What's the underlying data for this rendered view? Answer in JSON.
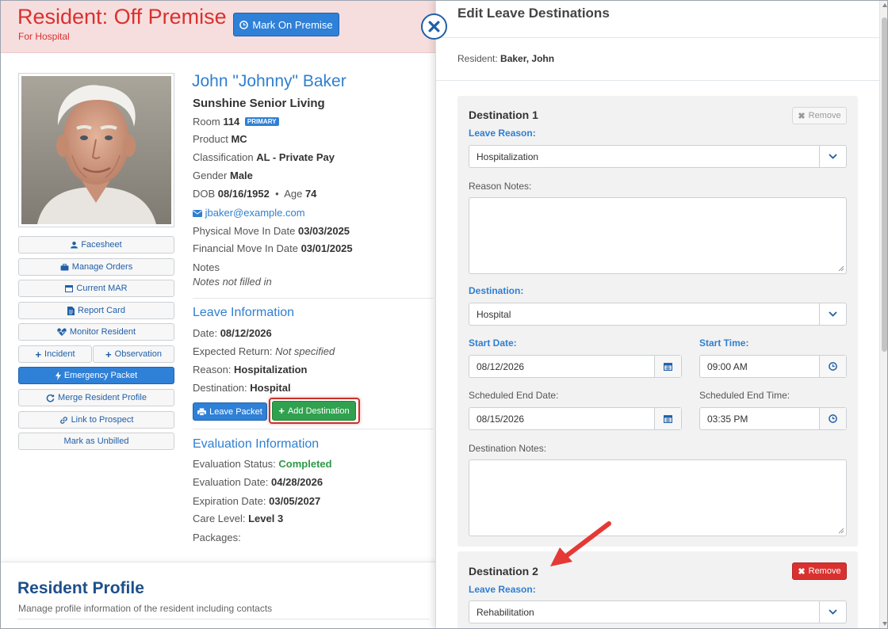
{
  "banner": {
    "title": "Resident: Off Premise",
    "subtitle": "For Hospital",
    "mark_on_premise": "Mark On Premise"
  },
  "side_buttons": {
    "facesheet": "Facesheet",
    "manage_orders": "Manage Orders",
    "current_mar": "Current MAR",
    "report_card": "Report Card",
    "monitor_resident": "Monitor Resident",
    "incident": "Incident",
    "observation": "Observation",
    "emergency_packet": "Emergency Packet",
    "merge_profile": "Merge Resident Profile",
    "link_prospect": "Link to Prospect",
    "mark_unbilled": "Mark as Unbilled"
  },
  "resident": {
    "name": "John \"Johnny\" Baker",
    "facility": "Sunshine Senior Living",
    "room_label": "Room",
    "room": "114",
    "room_badge": "PRIMARY",
    "product_label": "Product",
    "product": "MC",
    "classification_label": "Classification",
    "classification": "AL - Private Pay",
    "gender_label": "Gender",
    "gender": "Male",
    "dob_label": "DOB",
    "dob": "08/16/1952",
    "age_label": "Age",
    "age": "74",
    "email": "jbaker@example.com",
    "physical_move_in_label": "Physical Move In Date",
    "physical_move_in": "03/03/2025",
    "financial_move_in_label": "Financial Move In Date",
    "financial_move_in": "03/01/2025",
    "notes_label": "Notes",
    "notes_value": "Notes not filled in"
  },
  "leave": {
    "title": "Leave Information",
    "date_label": "Date:",
    "date": "08/12/2026",
    "expected_return_label": "Expected Return:",
    "expected_return": "Not specified",
    "reason_label": "Reason:",
    "reason": "Hospitalization",
    "destination_label": "Destination:",
    "destination": "Hospital",
    "leave_packet": "Leave Packet",
    "add_destination": "Add Destination"
  },
  "evaluation": {
    "title": "Evaluation Information",
    "status_label": "Evaluation Status:",
    "status": "Completed",
    "date_label": "Evaluation Date:",
    "date": "04/28/2026",
    "expiration_label": "Expiration Date:",
    "expiration": "03/05/2027",
    "care_level_label": "Care Level:",
    "care_level": "Level 3",
    "packages_label": "Packages:"
  },
  "profile": {
    "title": "Resident Profile",
    "subtitle": "Manage profile information of the resident including contacts"
  },
  "panel": {
    "title": "Edit Leave Destinations",
    "resident_label": "Resident:",
    "resident_name": "Baker, John",
    "remove_label": "Remove",
    "destinations": [
      {
        "title": "Destination 1",
        "leave_reason_label": "Leave Reason:",
        "leave_reason": "Hospitalization",
        "reason_notes_label": "Reason Notes:",
        "destination_label": "Destination:",
        "destination": "Hospital",
        "start_date_label": "Start Date:",
        "start_date": "08/12/2026",
        "start_time_label": "Start Time:",
        "start_time": "09:00 AM",
        "end_date_label": "Scheduled End Date:",
        "end_date": "08/15/2026",
        "end_time_label": "Scheduled End Time:",
        "end_time": "03:35 PM",
        "destination_notes_label": "Destination Notes:"
      },
      {
        "title": "Destination 2",
        "leave_reason_label": "Leave Reason:",
        "leave_reason": "Rehabilitation"
      }
    ]
  },
  "colors": {
    "banner_bg": "#f6dede",
    "banner_text": "#d9312f",
    "primary": "#2f80d7",
    "success": "#30a14e",
    "danger": "#d9312f",
    "link": "#2f7fd1",
    "highlight": "#c9302c"
  },
  "icons": {
    "mark_on_premise": "clock-icon",
    "facesheet": "user-icon",
    "manage_orders": "briefcase-icon",
    "current_mar": "calendar-icon",
    "report_card": "document-icon",
    "monitor_resident": "heartbeat-icon",
    "incident": "plus-icon",
    "observation": "plus-icon",
    "emergency_packet": "bolt-icon",
    "merge_profile": "refresh-icon",
    "link_prospect": "link-icon",
    "email": "envelope-icon",
    "leave_packet": "printer-icon",
    "add_destination": "plus-icon",
    "close": "close-circle-icon",
    "remove": "x-icon",
    "select": "chevron-down-icon",
    "date": "calendar-icon",
    "time": "clock-icon",
    "annotation": "red-arrow-icon"
  }
}
